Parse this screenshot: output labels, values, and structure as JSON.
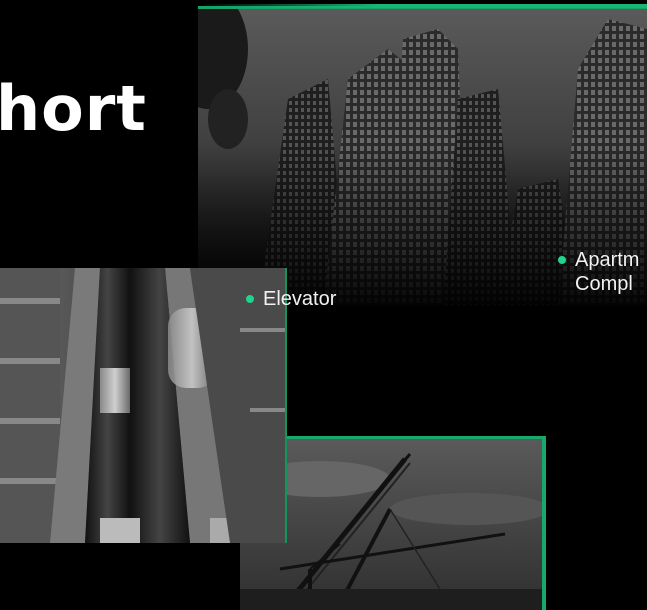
{
  "title": "hort",
  "captions": {
    "elevator": "Elevator",
    "apartment_line1": "Apartm",
    "apartment_line2": "Compl"
  },
  "colors": {
    "accent": "#1fd48c",
    "frame_border": "#17a86b",
    "background": "#000000"
  },
  "images": [
    {
      "name": "apartment-buildings-photo"
    },
    {
      "name": "elevator-photo"
    },
    {
      "name": "construction-cranes-photo"
    }
  ]
}
